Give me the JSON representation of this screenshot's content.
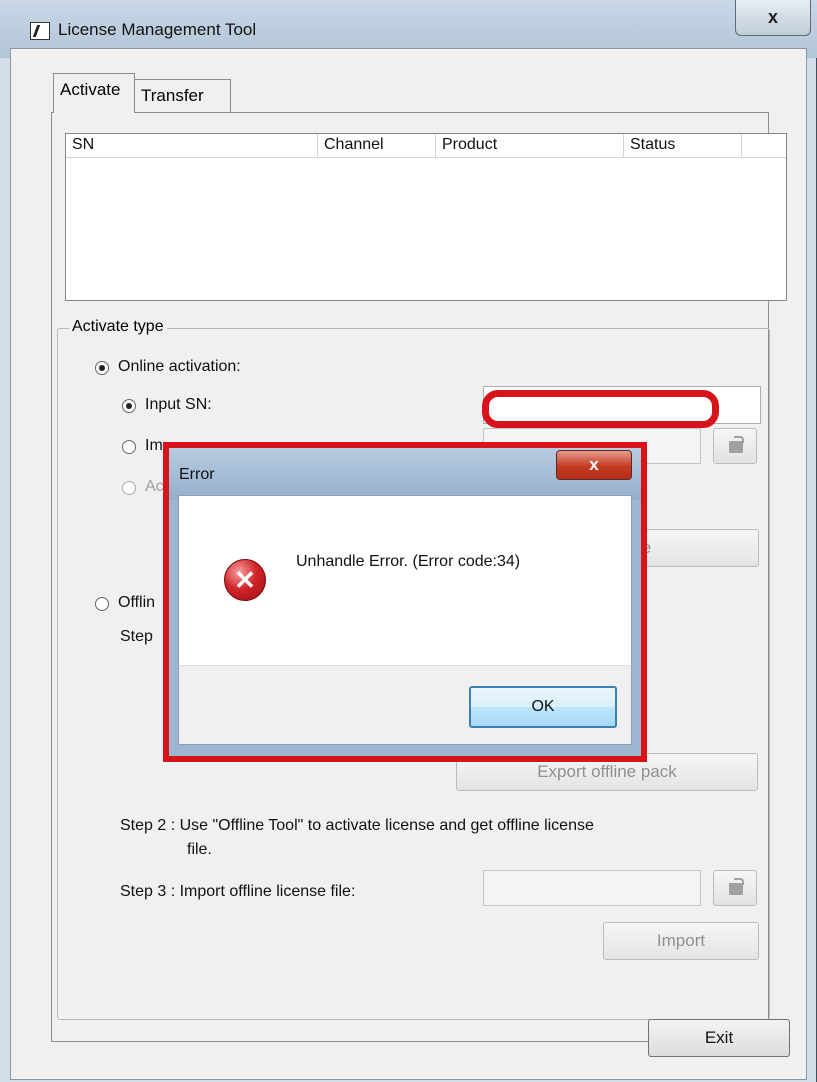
{
  "window": {
    "title": "License Management Tool",
    "close_label": "x"
  },
  "tabs": [
    {
      "label": "Activate",
      "selected": true
    },
    {
      "label": "Transfer",
      "selected": false
    }
  ],
  "license_table": {
    "columns": [
      "SN",
      "Channel",
      "Product",
      "Status"
    ],
    "rows": []
  },
  "activate_type": {
    "legend": "Activate type",
    "online": {
      "label": "Online activation:",
      "selected": true,
      "input_sn": {
        "label": "Input SN:",
        "selected": true,
        "value": ""
      },
      "import_option": {
        "label": "Im",
        "selected": false
      },
      "third_option": {
        "label": "Ac",
        "selected": false,
        "disabled": true
      },
      "activate_button": "Activate"
    },
    "offline": {
      "label": "Offlin",
      "selected": false,
      "step1": "Step",
      "export_button": "Export offline pack",
      "step2_line1": "Step 2 : Use \"Offline Tool\" to activate license and get offline license",
      "step2_line2": "file.",
      "step3": "Step 3 : Import offline license file:",
      "import_button": "Import"
    }
  },
  "exit_button": "Exit",
  "error_dialog": {
    "title": "Error",
    "close_label": "x",
    "message": "Unhandle Error. (Error code:34)",
    "icon": "error-icon",
    "ok_button": "OK"
  },
  "colors": {
    "highlight_red": "#d7141a",
    "ok_focus_border": "#3c7fb1"
  }
}
